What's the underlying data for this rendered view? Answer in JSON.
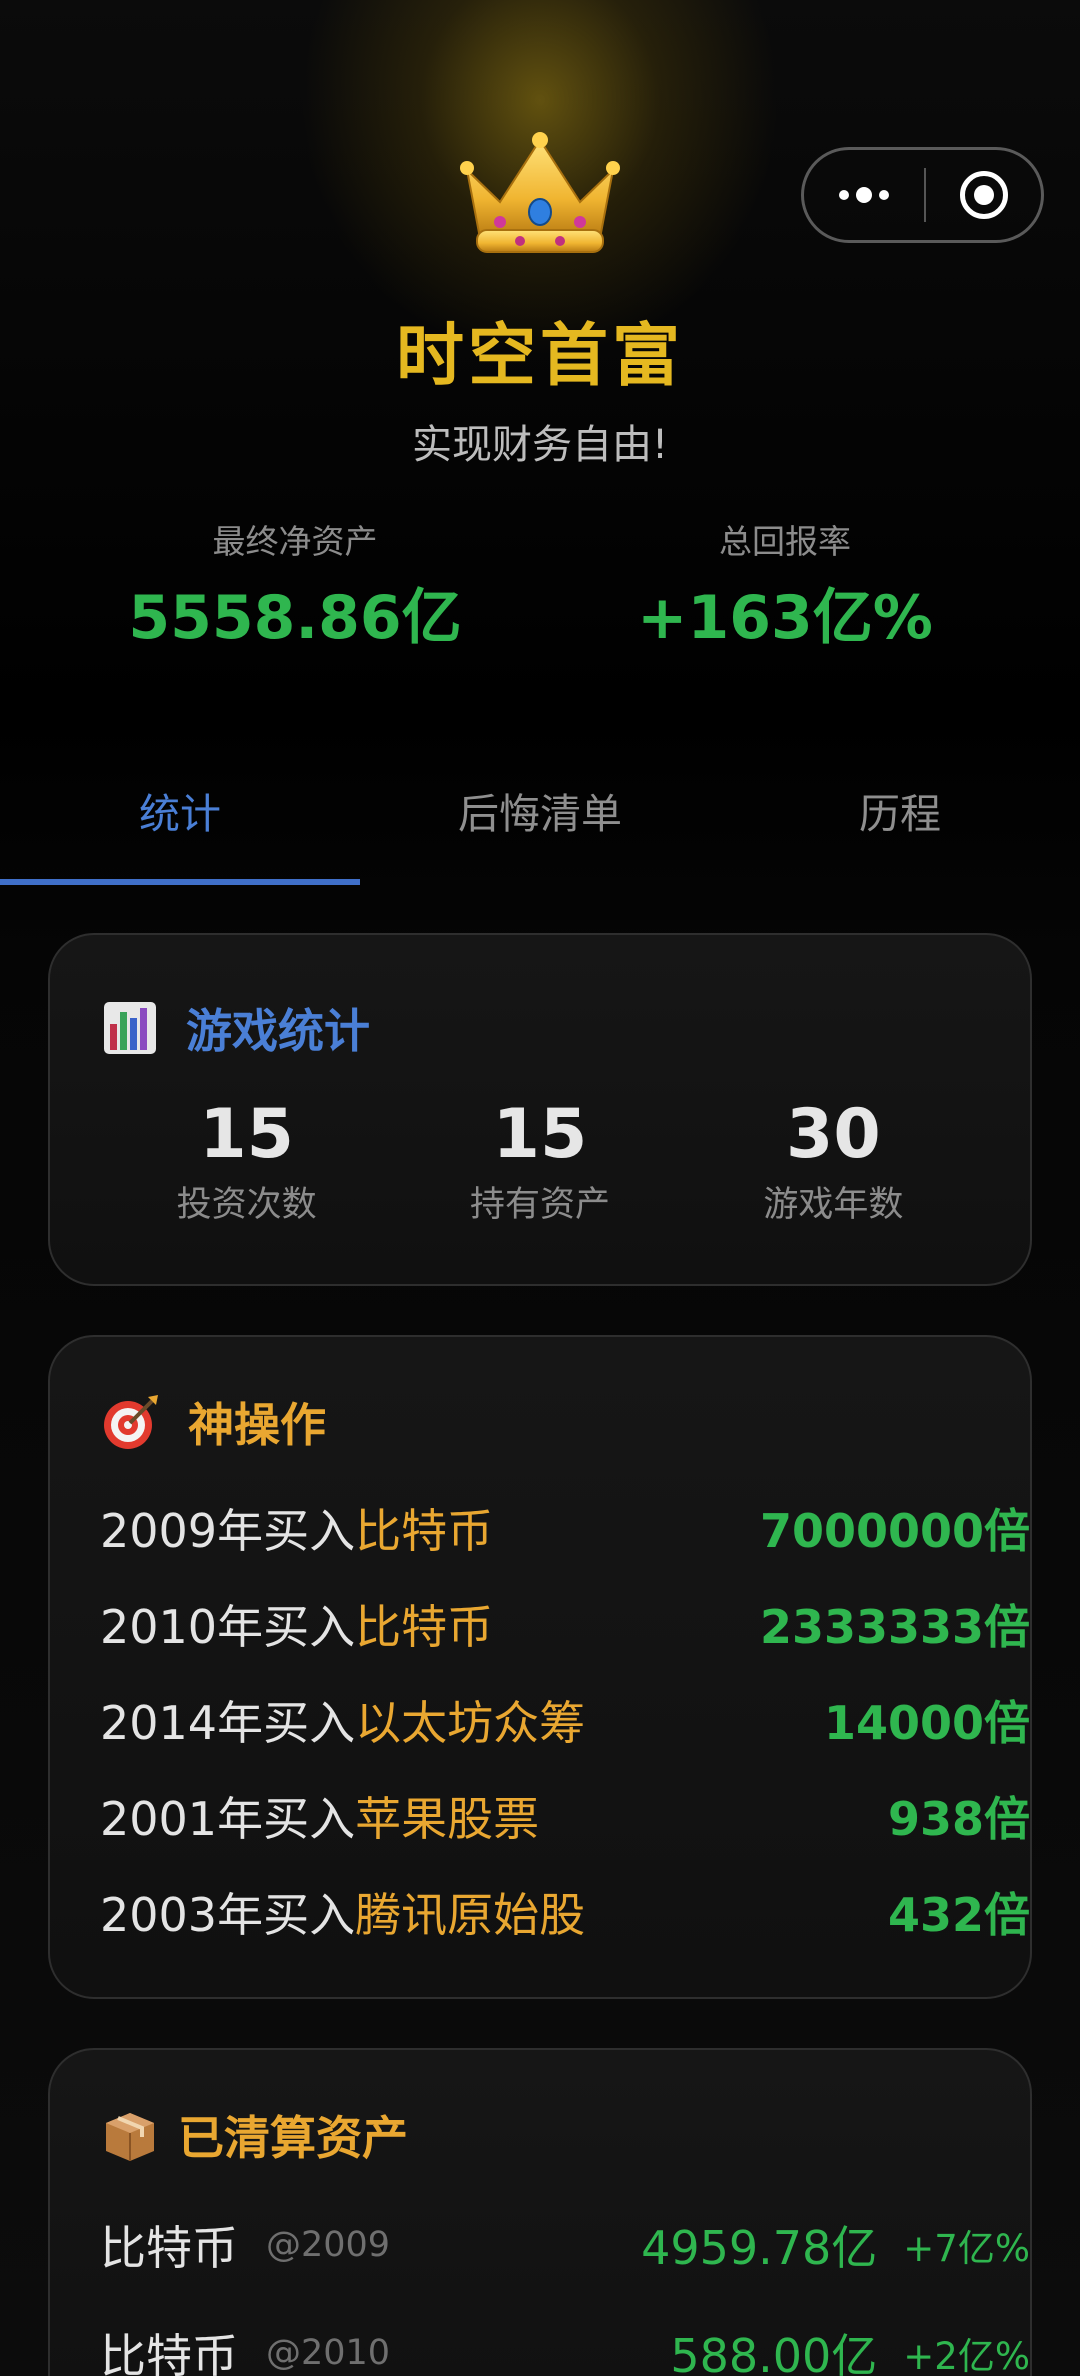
{
  "header": {
    "title": "时空首富",
    "subtitle": "实现财务自由!",
    "net_assets_label": "最终净资产",
    "net_assets_value": "5558.86亿",
    "return_label": "总回报率",
    "return_value": "+163亿%"
  },
  "tabs": [
    {
      "label": "统计",
      "active": true
    },
    {
      "label": "后悔清单",
      "active": false
    },
    {
      "label": "历程",
      "active": false
    }
  ],
  "game_stats": {
    "title": "游戏统计",
    "items": [
      {
        "value": "15",
        "label": "投资次数"
      },
      {
        "value": "15",
        "label": "持有资产"
      },
      {
        "value": "30",
        "label": "游戏年数"
      }
    ]
  },
  "best_moves": {
    "title": "神操作",
    "items": [
      {
        "prefix": "2009年买入",
        "asset": "比特币",
        "multiple": "7000000倍"
      },
      {
        "prefix": "2010年买入",
        "asset": "比特币",
        "multiple": "2333333倍"
      },
      {
        "prefix": "2014年买入",
        "asset": "以太坊众筹",
        "multiple": "14000倍"
      },
      {
        "prefix": "2001年买入",
        "asset": "苹果股票",
        "multiple": "938倍"
      },
      {
        "prefix": "2003年买入",
        "asset": "腾讯原始股",
        "multiple": "432倍"
      }
    ]
  },
  "liquidated": {
    "title": "已清算资产",
    "items": [
      {
        "name": "比特币",
        "year": "@2009",
        "amount": "4959.78亿",
        "ret": "+7亿%"
      },
      {
        "name": "比特币",
        "year": "@2010",
        "amount": "588.00亿",
        "ret": "+2亿%"
      }
    ]
  },
  "colors": {
    "gold": "#e5b820",
    "green": "#2fb64f",
    "blue": "#4a7fd6",
    "orange": "#e9a731"
  }
}
